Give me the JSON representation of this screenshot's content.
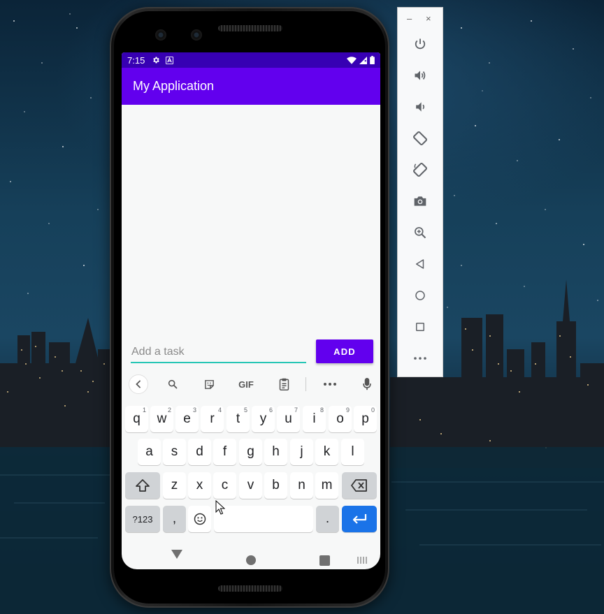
{
  "status_bar": {
    "time": "7:15",
    "left_icons": [
      "gear-icon",
      "a-badge-icon"
    ],
    "right_icons": [
      "wifi-icon",
      "signal-icon",
      "battery-icon"
    ]
  },
  "app_bar": {
    "title": "My Application"
  },
  "task_form": {
    "input_placeholder": "Add a task",
    "input_value": "",
    "add_label": "ADD"
  },
  "keyboard": {
    "toolbar": {
      "gif_label": "GIF",
      "icons": [
        "chevron-left-icon",
        "search-icon",
        "sticker-icon",
        "gif-icon",
        "clipboard-icon",
        "more-icon",
        "mic-icon"
      ]
    },
    "row1": [
      {
        "key": "q",
        "hint": "1"
      },
      {
        "key": "w",
        "hint": "2"
      },
      {
        "key": "e",
        "hint": "3"
      },
      {
        "key": "r",
        "hint": "4"
      },
      {
        "key": "t",
        "hint": "5"
      },
      {
        "key": "y",
        "hint": "6"
      },
      {
        "key": "u",
        "hint": "7"
      },
      {
        "key": "i",
        "hint": "8"
      },
      {
        "key": "o",
        "hint": "9"
      },
      {
        "key": "p",
        "hint": "0"
      }
    ],
    "row2": [
      "a",
      "s",
      "d",
      "f",
      "g",
      "h",
      "j",
      "k",
      "l"
    ],
    "row3": [
      "z",
      "x",
      "c",
      "v",
      "b",
      "n",
      "m"
    ],
    "symbols_label": "?123",
    "comma_label": ",",
    "period_label": "."
  },
  "emulator_panel": {
    "window_buttons": {
      "minimize": "–",
      "close": "×"
    },
    "controls": [
      {
        "name": "power",
        "icon": "power-icon"
      },
      {
        "name": "volume-up",
        "icon": "volume-up-icon"
      },
      {
        "name": "volume-down",
        "icon": "volume-down-icon"
      },
      {
        "name": "rotate-left",
        "icon": "rotate-left-icon"
      },
      {
        "name": "rotate-right",
        "icon": "rotate-right-icon"
      },
      {
        "name": "screenshot",
        "icon": "camera-icon"
      },
      {
        "name": "zoom",
        "icon": "zoom-in-icon"
      },
      {
        "name": "back",
        "icon": "back-triangle-icon"
      },
      {
        "name": "home",
        "icon": "home-circle-icon"
      },
      {
        "name": "overview",
        "icon": "overview-square-icon"
      },
      {
        "name": "more",
        "icon": "more-icon"
      }
    ]
  },
  "colors": {
    "status_bar": "#3700b3",
    "app_bar": "#6200ee",
    "accent_underline": "#26c6b5",
    "enter_key": "#1a73e8"
  }
}
